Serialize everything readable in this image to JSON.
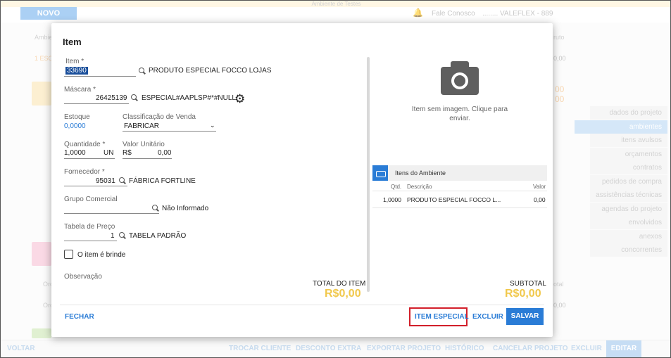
{
  "background": {
    "top_band": "Ambiente de Testes",
    "novo_label": "NOVO",
    "fale_conosco": "Fale Conosco",
    "company": "........ VALEFLEX - 889",
    "col_ambiente": "Ambie",
    "col_bruto": "ruto",
    "row1_label": "1 ESC",
    "row1_value": "0,00",
    "card_value1": "00",
    "card_value2": "00",
    "orc1": "Orç",
    "orc2": "Orç",
    "total_col": "otal",
    "val1": "0,00",
    "val2": "0,00"
  },
  "side_nav": [
    {
      "label": "dados do projeto",
      "active": false
    },
    {
      "label": "ambientes",
      "active": true
    },
    {
      "label": "itens avulsos",
      "active": false
    },
    {
      "label": "orçamentos",
      "active": false
    },
    {
      "label": "contratos",
      "active": false
    },
    {
      "label": "pedidos de compra",
      "active": false
    },
    {
      "label": "assistências técnicas",
      "active": false
    },
    {
      "label": "agendas do projeto",
      "active": false
    },
    {
      "label": "envolvidos",
      "active": false
    },
    {
      "label": "anexos",
      "active": false
    },
    {
      "label": "concorrentes",
      "active": false
    }
  ],
  "footer": {
    "voltar": "VOLTAR",
    "trocar_cliente": "TROCAR CLIENTE",
    "desconto_extra": "DESCONTO EXTRA",
    "exportar_projeto": "EXPORTAR PROJETO",
    "historico": "HISTÓRICO",
    "cancelar_projeto": "CANCELAR PROJETO",
    "excluir": "EXCLUIR",
    "editar": "EDITAR"
  },
  "modal": {
    "title": "Item",
    "item_label": "Item *",
    "item_code": "33690",
    "item_name": "PRODUTO ESPECIAL FOCCO LOJAS",
    "mascara_label": "Máscara *",
    "mascara_code": "26425139",
    "mascara_value": "ESPECIAL#AAPLSP#*#NULL",
    "estoque_label": "Estoque",
    "estoque_value": "0,0000",
    "classificacao_label": "Classificação de Venda",
    "classificacao_value": "FABRICAR",
    "quantidade_label": "Quantidade *",
    "quantidade_value": "1,0000",
    "quantidade_unit": "UN",
    "valor_unitario_label": "Valor Unitário",
    "valor_currency": "R$",
    "valor_unitario_value": "0,00",
    "fornecedor_label": "Fornecedor *",
    "fornecedor_code": "95031",
    "fornecedor_name": "FÁBRICA FORTLINE",
    "grupo_label": "Grupo Comercial",
    "grupo_value": "Não Informado",
    "tabela_label": "Tabela de Preço",
    "tabela_code": "1",
    "tabela_name": "TABELA PADRÃO",
    "brinde_label": "O item é brinde",
    "observacao_label": "Observação",
    "total_item_label": "TOTAL DO ITEM",
    "total_item_value": "R$0,00",
    "no_image_text": "Item sem imagem. Clique para enviar.",
    "itens_ambiente_title": "Itens do Ambiente",
    "table_headers": {
      "qtd": "Qtd.",
      "descricao": "Descrição",
      "valor": "Valor"
    },
    "table_rows": [
      {
        "qtd": "1,0000",
        "descricao": "PRODUTO ESPECIAL FOCCO L...",
        "valor": "0,00"
      }
    ],
    "subtotal_label": "SUBTOTAL",
    "subtotal_value": "R$0,00",
    "fechar": "FECHAR",
    "item_especial": "ITEM ESPECIAL",
    "excluir": "EXCLUIR",
    "salvar": "SALVAR"
  },
  "colors": {
    "accent": "#2a7cd6",
    "total": "#f1c84b",
    "highlight": "#d21f2a"
  }
}
